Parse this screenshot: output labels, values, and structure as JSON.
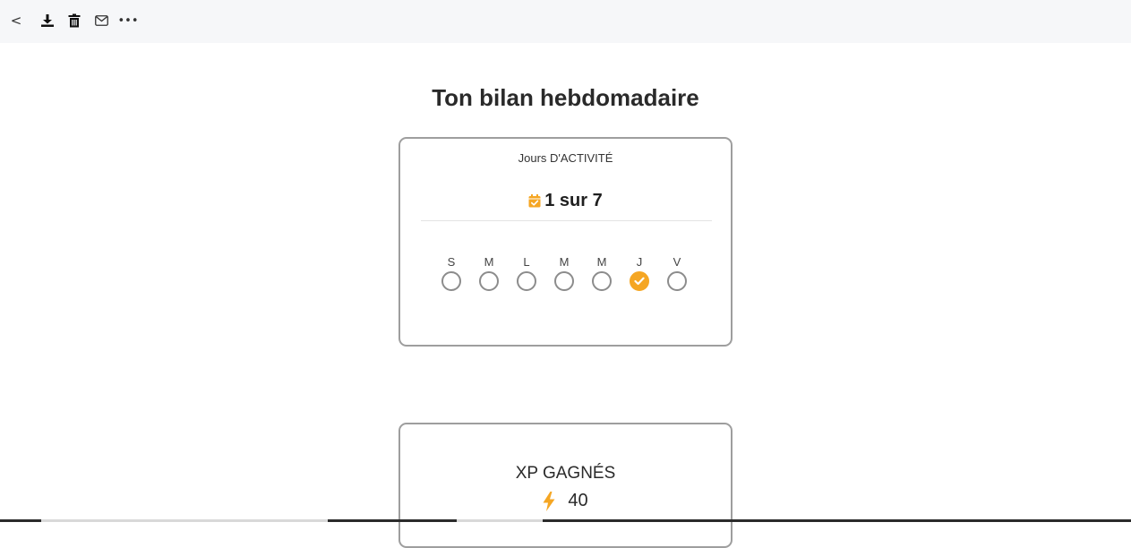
{
  "toolbar": {
    "back_glyph": "<",
    "more_glyph": "•••",
    "icons": [
      "chevron-left-icon",
      "download-icon",
      "trash-icon",
      "mail-icon",
      "more-horizontal-icon"
    ]
  },
  "page": {
    "title": "Ton bilan hebdomadaire"
  },
  "activity_card": {
    "label": "Jours D'ACTIVITÉ",
    "count": "1 sur 7",
    "calendar_icon": "calendar-check-icon",
    "days": [
      {
        "letter": "S",
        "done": false
      },
      {
        "letter": "M",
        "done": false
      },
      {
        "letter": "L",
        "done": false
      },
      {
        "letter": "M",
        "done": false
      },
      {
        "letter": "M",
        "done": false
      },
      {
        "letter": "J",
        "done": true
      },
      {
        "letter": "V",
        "done": false
      }
    ]
  },
  "xp_card": {
    "label": "XP GAGNÉS",
    "value": "40",
    "icon": "lightning-bolt-icon"
  },
  "colors": {
    "accent": "#f5a623",
    "circle_border": "#8c8c8c",
    "card_border": "#9e9e9e"
  }
}
